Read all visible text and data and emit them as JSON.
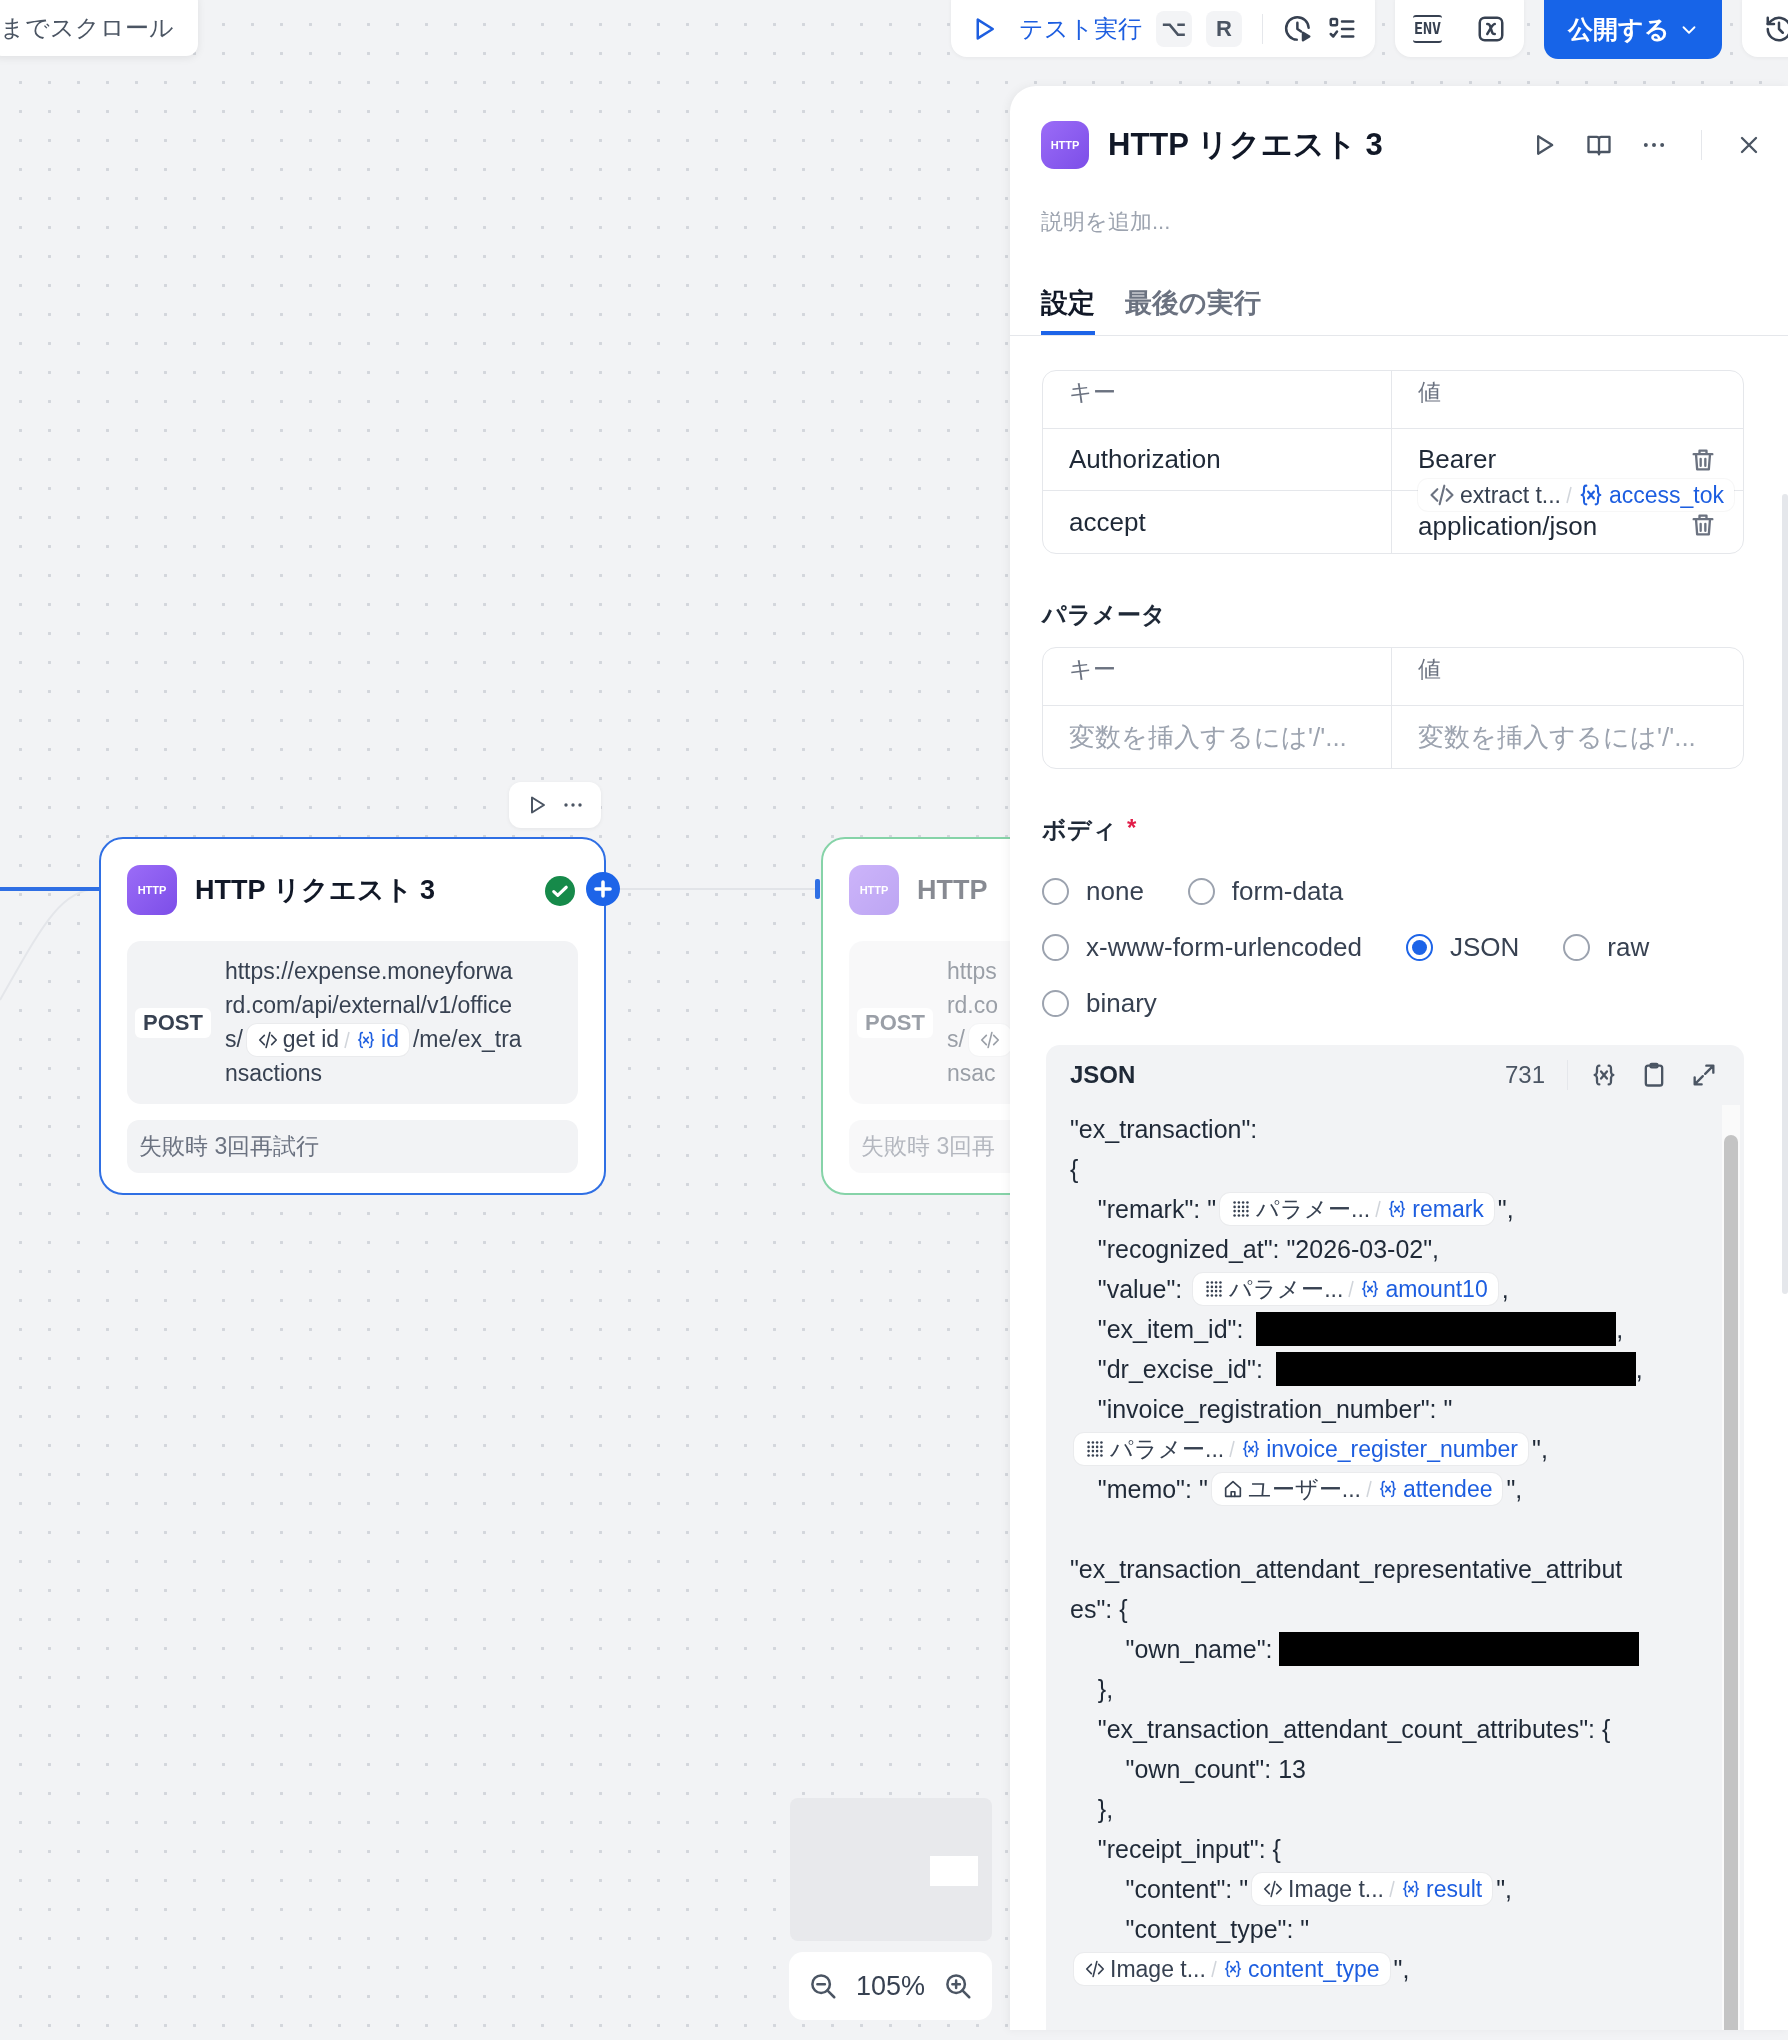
{
  "canvas_toast": {
    "text": "までスクロール"
  },
  "toolbar": {
    "test_run": {
      "label": "テスト実行",
      "keys": [
        "⌥",
        "R"
      ]
    },
    "env_label": "ENV",
    "publish": {
      "label": "公開する"
    }
  },
  "nodes": [
    {
      "badge": "HTTP",
      "title": "HTTP リクエスト 3",
      "selected": true,
      "dimmed": false,
      "succeeded": true,
      "method": "POST",
      "url_lines": [
        [
          {
            "kind": "text",
            "text": "https://expense.moneyforwa"
          }
        ],
        [
          {
            "kind": "text",
            "text": "rd.com/api/external/v1/office"
          }
        ],
        [
          {
            "kind": "text",
            "text": "s/"
          },
          {
            "kind": "chip",
            "source": {
              "kind": "code",
              "text": "get id"
            },
            "variable": "id"
          },
          {
            "kind": "text",
            "text": "/me/ex_tra"
          }
        ],
        [
          {
            "kind": "text",
            "text": "nsactions"
          }
        ]
      ],
      "retry": "失敗時 3回再試行"
    },
    {
      "badge": "HTTP",
      "title": "HTTP",
      "selected": false,
      "dimmed": true,
      "succeeded": true,
      "method": "POST",
      "url_lines": [
        [
          {
            "kind": "text",
            "text": "https"
          }
        ],
        [
          {
            "kind": "text",
            "text": "rd.co"
          }
        ],
        [
          {
            "kind": "text",
            "text": "s/"
          },
          {
            "kind": "chip",
            "source": {
              "kind": "code"
            }
          }
        ],
        [
          {
            "kind": "text",
            "text": "nsac"
          }
        ]
      ],
      "retry": "失敗時 3回再"
    }
  ],
  "zoom": {
    "level_text": "105%"
  },
  "panel": {
    "badge": "HTTP",
    "title": "HTTP リクエスト 3",
    "description": {
      "placeholder": "説明を追加..."
    },
    "tabs": [
      {
        "label": "設定",
        "selected": true
      },
      {
        "label": "最後の実行",
        "selected": false
      }
    ],
    "headers": {
      "columns": [
        "キー",
        "値"
      ],
      "rows": [
        {
          "key": "Authorization",
          "value": "Bearer",
          "chip": {
            "source": {
              "kind": "code",
              "text": "extract t..."
            },
            "variable": "access_tok"
          }
        },
        {
          "key": "accept",
          "value": "application/json"
        }
      ]
    },
    "params": {
      "title": "パラメータ",
      "columns": [
        "キー",
        "値"
      ],
      "rows": [
        {
          "key": {
            "placeholder": "変数を挿入するには'/'..."
          },
          "value": {
            "placeholder": "変数を挿入するには'/'..."
          }
        }
      ]
    },
    "body": {
      "title": "ボディ",
      "required_mark": "*",
      "option_rows": [
        [
          {
            "label": "none",
            "selected": false
          },
          {
            "label": "form-data",
            "selected": false
          }
        ],
        [
          {
            "label": "x-www-form-urlencoded",
            "selected": false
          },
          {
            "label": "JSON",
            "selected": true
          },
          {
            "label": "raw",
            "selected": false
          }
        ],
        [
          {
            "label": "binary",
            "selected": false
          }
        ]
      ],
      "editor": {
        "title": "JSON",
        "count": "731",
        "lines": [
          {
            "kind": "code",
            "segments": [
              {
                "kind": "text",
                "text": "\"ex_transaction\":"
              }
            ]
          },
          {
            "kind": "code",
            "segments": [
              {
                "kind": "text",
                "text": "{"
              }
            ]
          },
          {
            "kind": "code",
            "segments": [
              {
                "kind": "text",
                "text": "    \"remark\": \""
              },
              {
                "kind": "chip",
                "source": {
                  "kind": "parameter",
                  "text": "パラメー..."
                },
                "variable": "remark"
              },
              {
                "kind": "text",
                "text": "\","
              }
            ]
          },
          {
            "kind": "code",
            "segments": [
              {
                "kind": "text",
                "text": "    \"recognized_at\": \"2026-03-02\","
              }
            ]
          },
          {
            "kind": "code",
            "segments": [
              {
                "kind": "text",
                "text": "    \"value\": "
              },
              {
                "kind": "chip",
                "source": {
                  "kind": "parameter",
                  "text": "パラメー..."
                },
                "variable": "amount10"
              },
              {
                "kind": "text",
                "text": ","
              }
            ]
          },
          {
            "kind": "code",
            "segments": [
              {
                "kind": "text",
                "text": "    \"ex_item_id\": "
              },
              {
                "kind": "redacted"
              },
              {
                "kind": "text",
                "text": ","
              }
            ]
          },
          {
            "kind": "code",
            "segments": [
              {
                "kind": "text",
                "text": "    \"dr_excise_id\": "
              },
              {
                "kind": "redacted"
              },
              {
                "kind": "text",
                "text": ","
              }
            ]
          },
          {
            "kind": "code",
            "segments": [
              {
                "kind": "text",
                "text": "    \"invoice_registration_number\": \""
              }
            ]
          },
          {
            "kind": "code",
            "segments": [
              {
                "kind": "chip",
                "source": {
                  "kind": "parameter",
                  "text": "パラメー..."
                },
                "variable": "invoice_register_number"
              },
              {
                "kind": "text",
                "text": "\","
              }
            ]
          },
          {
            "kind": "code",
            "segments": [
              {
                "kind": "text",
                "text": "    \"memo\": \""
              },
              {
                "kind": "chip",
                "source": {
                  "kind": "user",
                  "text": "ユーザー..."
                },
                "variable": "attendee"
              },
              {
                "kind": "text",
                "text": "\","
              }
            ]
          },
          {
            "kind": "blank"
          },
          {
            "kind": "code",
            "segments": [
              {
                "kind": "text",
                "text": "\"ex_transaction_attendant_representative_attribut"
              }
            ]
          },
          {
            "kind": "code",
            "segments": [
              {
                "kind": "text",
                "text": "es\": {"
              }
            ]
          },
          {
            "kind": "code",
            "segments": [
              {
                "kind": "text",
                "text": "        \"own_name\":"
              },
              {
                "kind": "redacted"
              }
            ]
          },
          {
            "kind": "code",
            "segments": [
              {
                "kind": "text",
                "text": "    },"
              }
            ]
          },
          {
            "kind": "code",
            "segments": [
              {
                "kind": "text",
                "text": "    \"ex_transaction_attendant_count_attributes\": {"
              }
            ]
          },
          {
            "kind": "code",
            "segments": [
              {
                "kind": "text",
                "text": "        \"own_count\": 13"
              }
            ]
          },
          {
            "kind": "code",
            "segments": [
              {
                "kind": "text",
                "text": "    },"
              }
            ]
          },
          {
            "kind": "code",
            "segments": [
              {
                "kind": "text",
                "text": "    \"receipt_input\": {"
              }
            ]
          },
          {
            "kind": "code",
            "segments": [
              {
                "kind": "text",
                "text": "        \"content\": \""
              },
              {
                "kind": "chip",
                "source": {
                  "kind": "code",
                  "text": "Image t..."
                },
                "variable": "result"
              },
              {
                "kind": "text",
                "text": "\","
              }
            ]
          },
          {
            "kind": "code",
            "segments": [
              {
                "kind": "text",
                "text": "        \"content_type\": \""
              }
            ]
          },
          {
            "kind": "code",
            "segments": [
              {
                "kind": "chip",
                "source": {
                  "kind": "code",
                  "text": "Image t..."
                },
                "variable": "content_type"
              },
              {
                "kind": "text",
                "text": "\","
              }
            ]
          }
        ]
      }
    }
  }
}
